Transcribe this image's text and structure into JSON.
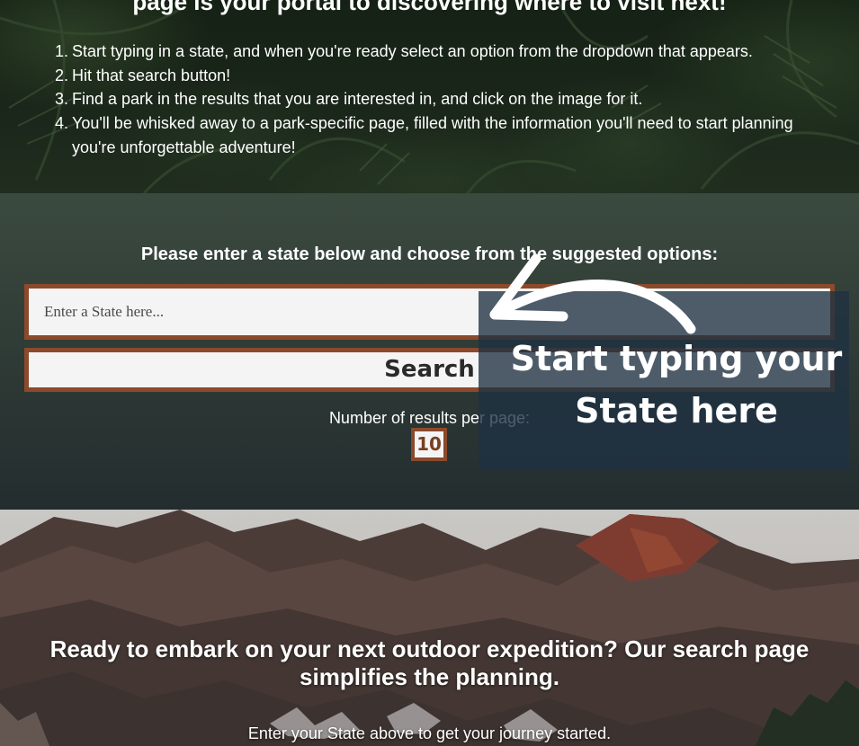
{
  "top": {
    "heading": "page is your portal to discovering where to visit next!",
    "steps": [
      {
        "num": "1.",
        "text": "Start typing in a state, and when you're ready select an option from the dropdown that appears."
      },
      {
        "num": "2.",
        "text": "Hit that search button!"
      },
      {
        "num": "3.",
        "text": "Find a park in the results that you are interested in, and click on the image for it."
      },
      {
        "num": "4.",
        "text": "You'll be whisked away to a park-specific page, filled with the information you'll need to start planning you're unforgettable adventure!"
      }
    ]
  },
  "search": {
    "prompt": "Please enter a state below and choose from the suggested options:",
    "placeholder": "Enter a State here...",
    "button_label": "Search",
    "results_label": "Number of results per page:",
    "results_value": "10"
  },
  "tooltip": {
    "line1": "Start typing your",
    "line2": "State here"
  },
  "cta": {
    "title": "Ready to embark on your next outdoor expedition? Our search page simplifies the planning.",
    "subtitle": "Enter your State above to get your journey started."
  },
  "colors": {
    "accent_border": "#8b4a2b",
    "tooltip_bg": "#1f3142"
  }
}
